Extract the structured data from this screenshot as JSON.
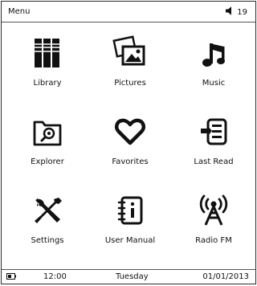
{
  "header": {
    "title": "Menu",
    "volume_level": "19",
    "volume_icon": "speaker-icon"
  },
  "menu": {
    "items": [
      {
        "label": "Library",
        "icon": "library-icon"
      },
      {
        "label": "Pictures",
        "icon": "pictures-icon"
      },
      {
        "label": "Music",
        "icon": "music-note-icon"
      },
      {
        "label": "Explorer",
        "icon": "explorer-icon"
      },
      {
        "label": "Favorites",
        "icon": "heart-icon"
      },
      {
        "label": "Last Read",
        "icon": "last-read-icon"
      },
      {
        "label": "Settings",
        "icon": "settings-icon"
      },
      {
        "label": "User Manual",
        "icon": "user-manual-icon"
      },
      {
        "label": "Radio FM",
        "icon": "radio-icon"
      }
    ]
  },
  "status": {
    "time": "12:00",
    "day": "Tuesday",
    "date": "01/01/2013",
    "battery_icon": "battery-icon"
  }
}
